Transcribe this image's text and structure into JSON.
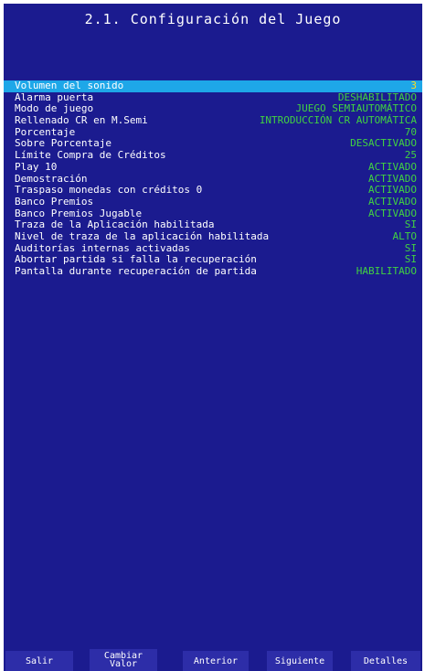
{
  "title": "2.1. Configuración del Juego",
  "settings": [
    {
      "label": "Volumen del sonido",
      "value": "3"
    },
    {
      "label": "Alarma puerta",
      "value": "DESHABILITADO"
    },
    {
      "label": "Modo de juego",
      "value": "JUEGO SEMIAUTOMÁTICO"
    },
    {
      "label": "Rellenado CR en M.Semi",
      "value": "INTRODUCCIÓN CR AUTOMÁTICA"
    },
    {
      "label": "Porcentaje",
      "value": "70"
    },
    {
      "label": "Sobre Porcentaje",
      "value": "DESACTIVADO"
    },
    {
      "label": "Límite Compra de Créditos",
      "value": "25"
    },
    {
      "label": "Play 10",
      "value": "ACTIVADO"
    },
    {
      "label": "Demostración",
      "value": "ACTIVADO"
    },
    {
      "label": "Traspaso monedas con créditos 0",
      "value": "ACTIVADO"
    },
    {
      "label": "Banco Premios",
      "value": "ACTIVADO"
    },
    {
      "label": "Banco Premios Jugable",
      "value": "ACTIVADO"
    },
    {
      "label": "Traza de la Aplicación habilitada",
      "value": "SI"
    },
    {
      "label": "Nivel de traza de la aplicación habilitada",
      "value": "ALTO"
    },
    {
      "label": "Auditorías internas activadas",
      "value": "SI"
    },
    {
      "label": "Abortar partida si falla la recuperación",
      "value": "SI"
    },
    {
      "label": "Pantalla durante recuperación de partida",
      "value": "HABILITADO"
    }
  ],
  "selected_index": 0,
  "footer": {
    "exit": "Salir",
    "change_value_line1": "Cambiar",
    "change_value_line2": "Valor",
    "previous": "Anterior",
    "next": "Siguiente",
    "details": "Detalles"
  },
  "colors": {
    "background": "#1b1b8f",
    "value_text": "#41d241",
    "selected_row": "#1ea7e8",
    "selected_value": "#ffdc1e",
    "button": "#2d2da8"
  }
}
